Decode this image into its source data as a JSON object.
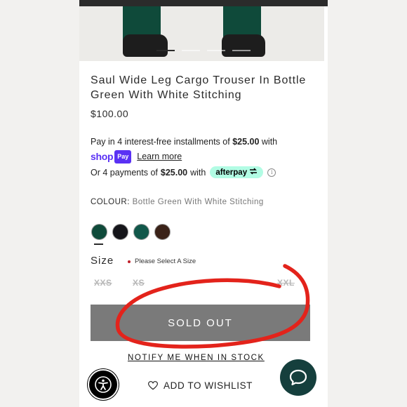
{
  "product": {
    "title": "Saul Wide Leg Cargo Trouser In Bottle Green With White Stitching",
    "price": "$100.00"
  },
  "shoppay": {
    "text_prefix": "Pay in 4 interest-free installments of",
    "amount": "$25.00",
    "text_suffix": "with",
    "logo_text": "shop",
    "badge_text": "Pay",
    "learn_more": "Learn more"
  },
  "afterpay": {
    "prefix": "Or 4 payments of",
    "amount": "$25.00",
    "suffix": "with",
    "badge": "afterpay",
    "info_icon": "i"
  },
  "colour": {
    "label": "COLOUR:",
    "value": "Bottle Green With White Stitching",
    "swatches": [
      {
        "name": "bottle-green",
        "color": "#0f4a3a"
      },
      {
        "name": "black",
        "color": "#15151a"
      },
      {
        "name": "teal-green",
        "color": "#11574a"
      },
      {
        "name": "brown",
        "color": "#3a2218"
      }
    ]
  },
  "size": {
    "label": "Size",
    "warning": "Please Select A Size",
    "options": [
      "XXS",
      "XS",
      "XXL"
    ]
  },
  "buttons": {
    "sold_out": "SOLD OUT",
    "notify": "NOTIFY ME WHEN IN STOCK",
    "wishlist": "ADD TO WISHLIST"
  },
  "icons": {
    "accessibility": "accessibility-icon",
    "chat": "chat-bubble-icon",
    "heart": "heart-icon"
  },
  "colors": {
    "sold_out_bg": "#7a7a7a",
    "chat_bg": "#153f3d",
    "annotation": "#e3231b"
  }
}
